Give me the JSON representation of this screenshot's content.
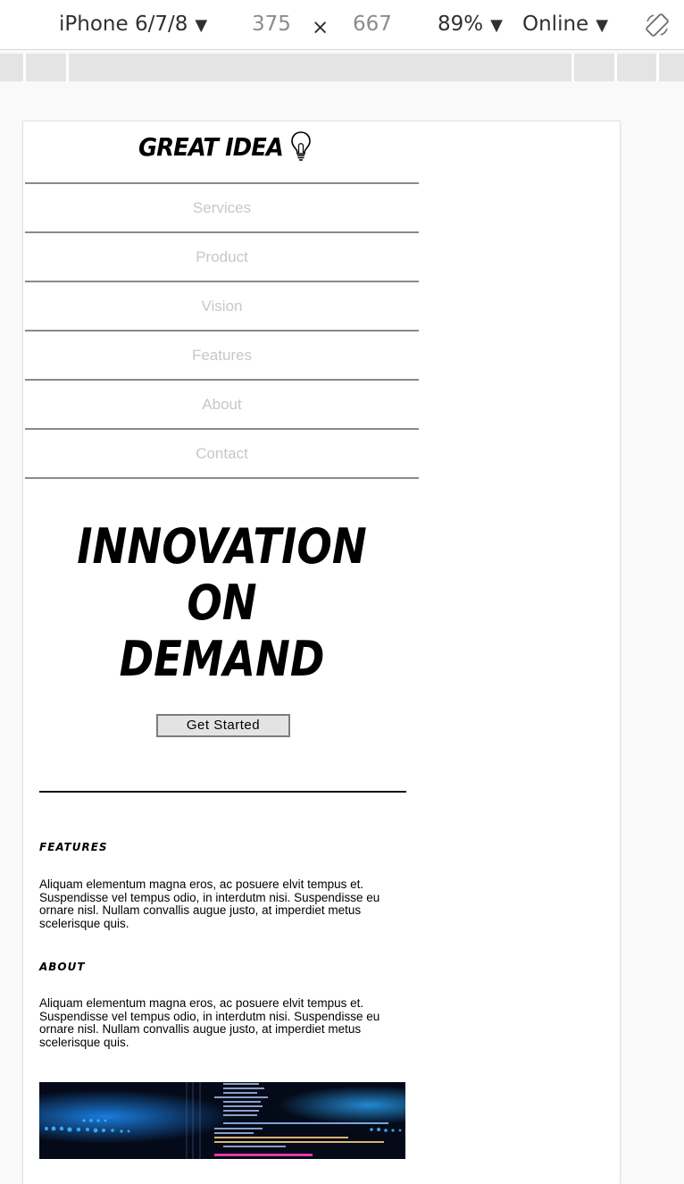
{
  "devtools": {
    "device": "iPhone 6/7/8",
    "width": "375",
    "times": "×",
    "height": "667",
    "zoom": "89%",
    "network": "Online",
    "caret": "▼"
  },
  "site": {
    "logo_text": "GREAT IDEA",
    "nav": [
      "Services",
      "Product",
      "Vision",
      "Features",
      "About",
      "Contact"
    ],
    "hero": [
      "INNOVATION",
      "ON",
      "DEMAND"
    ],
    "cta_label": "Get Started",
    "sections": [
      {
        "title": "FEATURES",
        "text": "Aliquam elementum magna eros, ac posuere elvit tempus et. Suspendisse vel tempus odio, in interdutm nisi. Suspendisse eu ornare nisl. Nullam convallis augue justo, at imperdiet metus scelerisque quis."
      },
      {
        "title": "ABOUT",
        "text": "Aliquam elementum magna eros, ac posuere elvit tempus et. Suspendisse vel tempus odio, in interdutm nisi. Suspendisse eu ornare nisl. Nullam convallis augue justo, at imperdiet metus scelerisque quis."
      }
    ]
  },
  "colors": {
    "nav_text": "#c7c7c7",
    "nav_border": "#8a8a8a",
    "button_bg": "#e3e3e3",
    "code_bg": "#050a18",
    "code_blue": "#1e90ff"
  }
}
